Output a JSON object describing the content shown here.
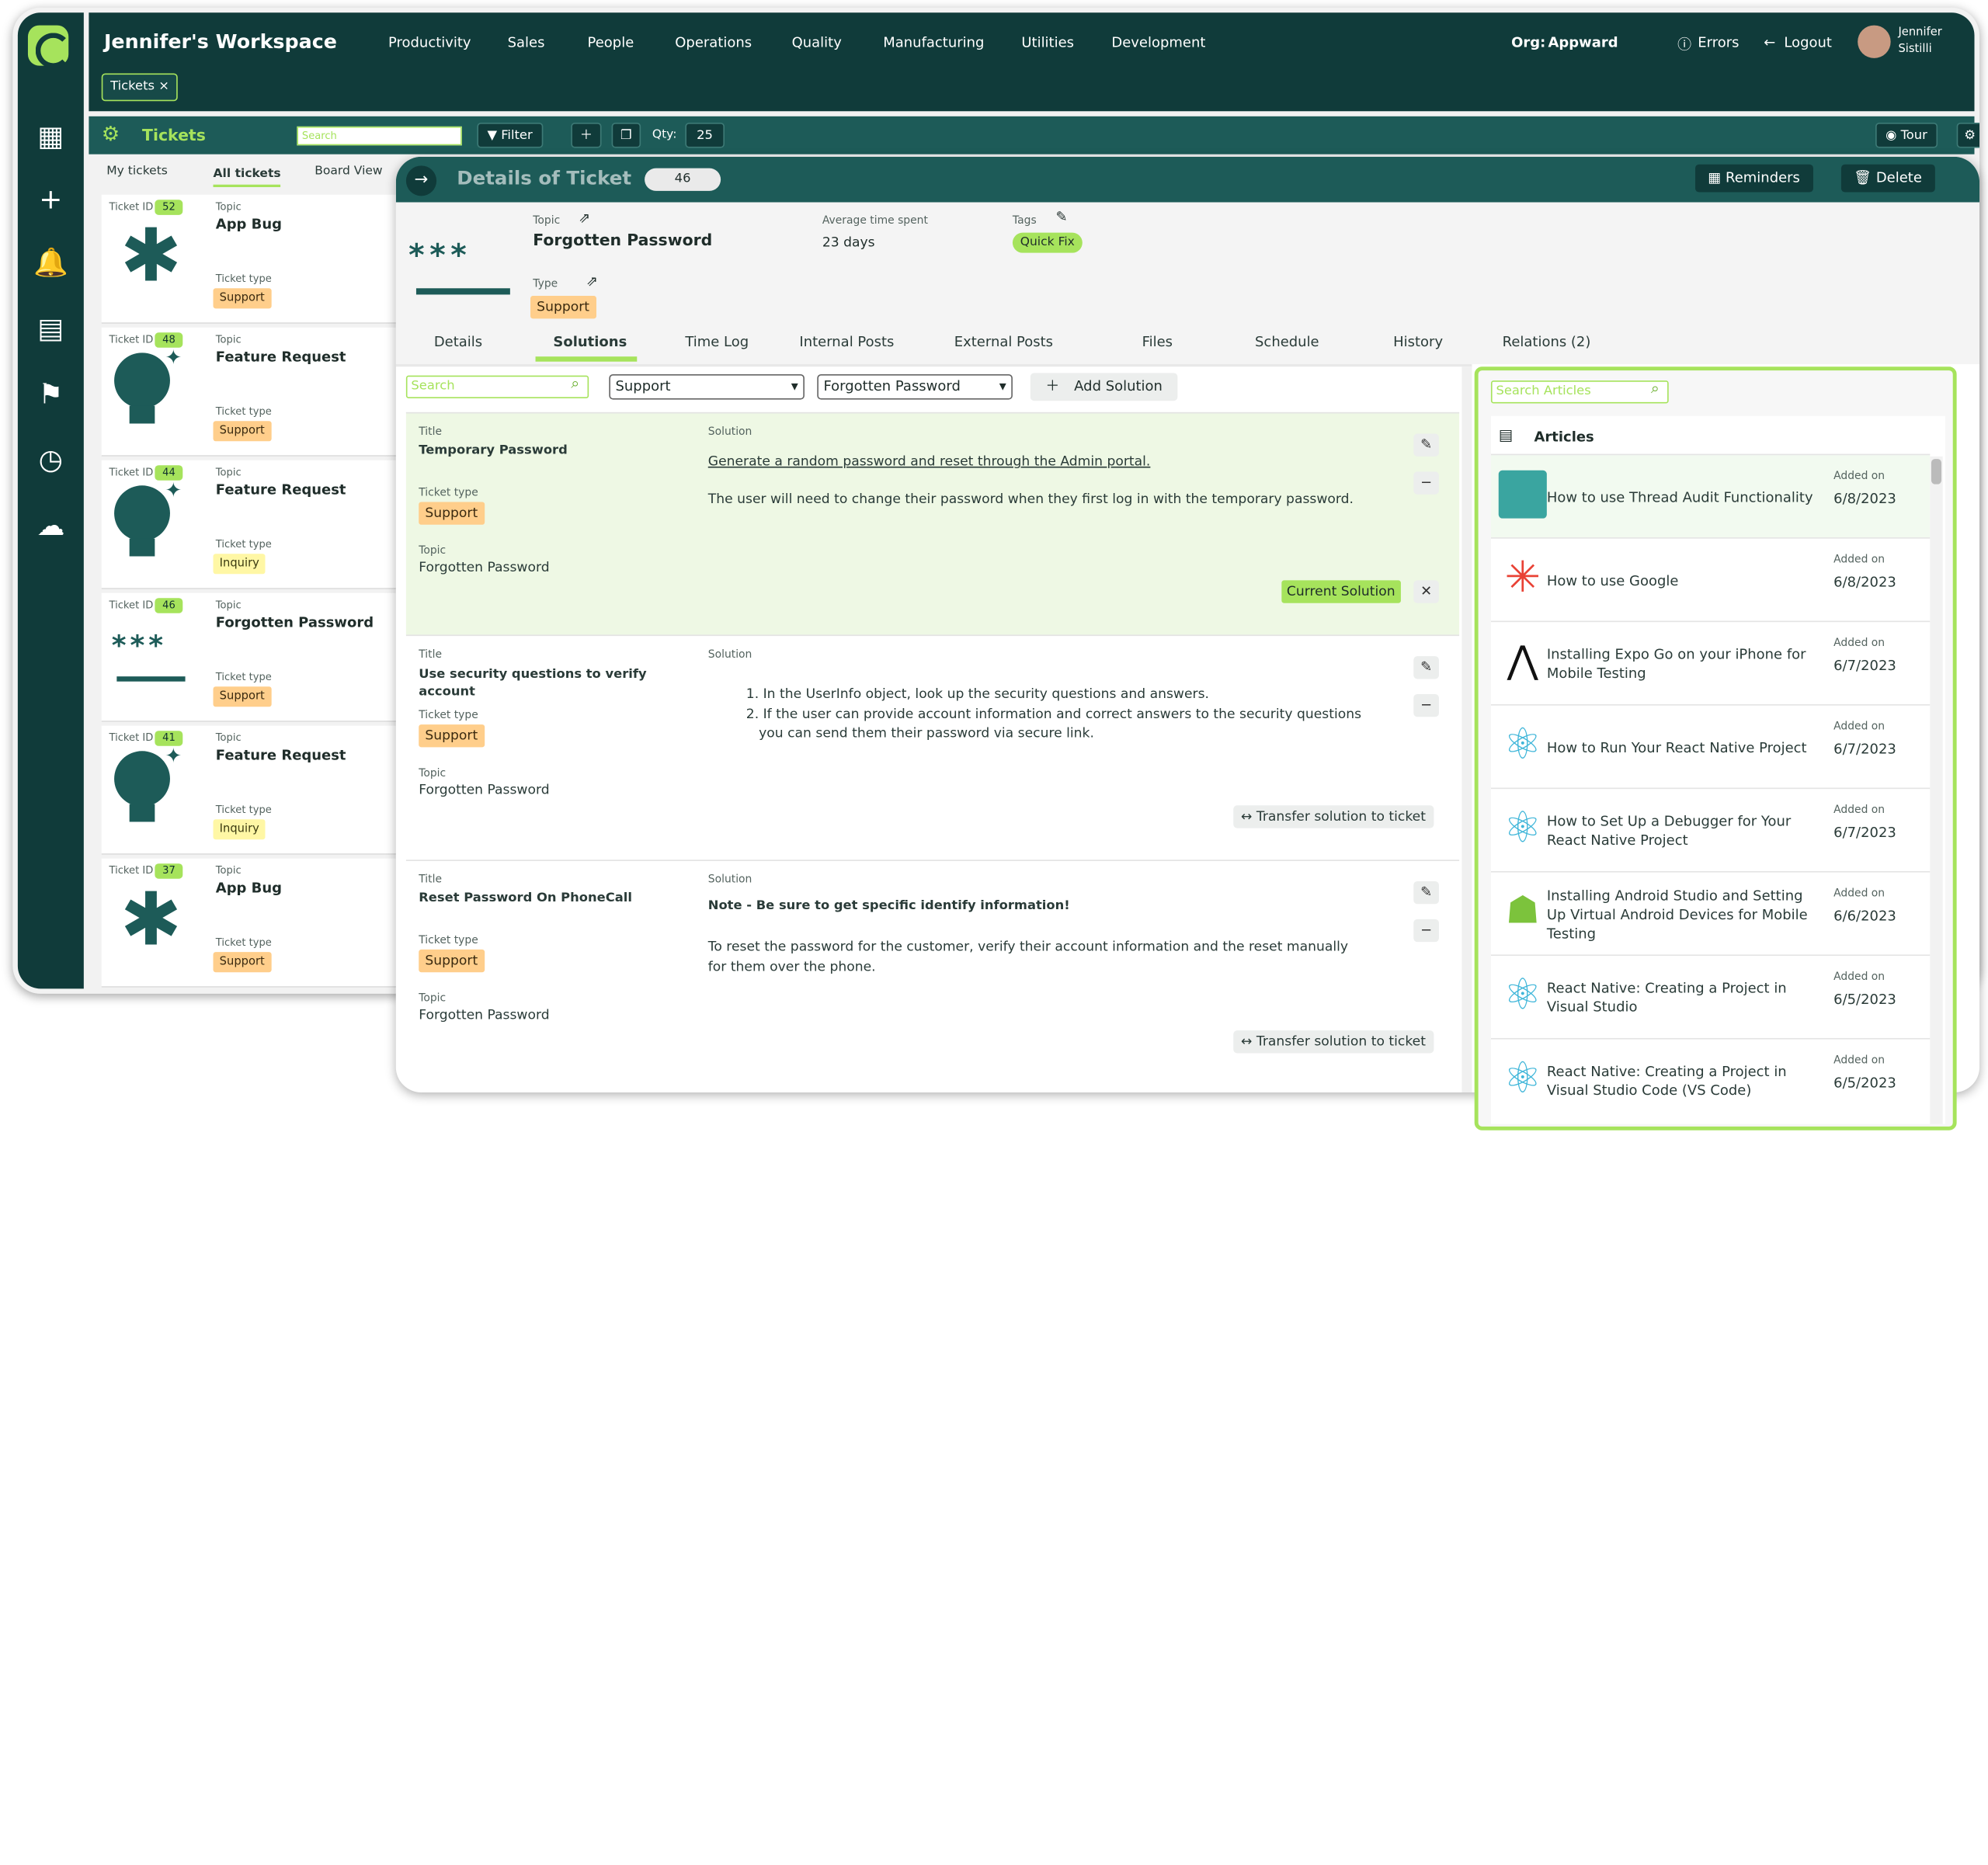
{
  "app": {
    "workspace_title": "Jennifer's Workspace",
    "org_label": "Org:",
    "org_name": "Appward",
    "errors": "Errors",
    "logout": "Logout",
    "user_first": "Jennifer",
    "user_last": "Sistilli",
    "open_tab": "Tickets"
  },
  "nav": [
    "Productivity",
    "Sales",
    "People",
    "Operations",
    "Quality",
    "Manufacturing",
    "Utilities",
    "Development"
  ],
  "toolbar": {
    "title": "Tickets",
    "search_placeholder": "Search",
    "filter": "Filter",
    "qty_label": "Qty:",
    "qty": "25",
    "tour": "Tour"
  },
  "left_tabs": [
    "My tickets",
    "All tickets",
    "Board View"
  ],
  "ticket_labels": {
    "id": "Ticket ID",
    "topic": "Topic",
    "type": "Ticket type"
  },
  "tickets": [
    {
      "id": "52",
      "topic": "App Bug",
      "type": "Support",
      "icon": "bug-icon"
    },
    {
      "id": "48",
      "topic": "Feature Request",
      "type": "Support",
      "icon": "lightbulb-icon"
    },
    {
      "id": "44",
      "topic": "Feature Request",
      "type": "Inquiry",
      "icon": "lightbulb-icon"
    },
    {
      "id": "46",
      "topic": "Forgotten Password",
      "type": "Support",
      "icon": "password-icon"
    },
    {
      "id": "41",
      "topic": "Feature Request",
      "type": "Inquiry",
      "icon": "lightbulb-icon"
    },
    {
      "id": "37",
      "topic": "App Bug",
      "type": "Support",
      "icon": "bug-icon"
    }
  ],
  "detail": {
    "title": "Details of Ticket",
    "id": "46",
    "reminders": "Reminders",
    "delete": "Delete",
    "topic_label": "Topic",
    "topic": "Forgotten Password",
    "type_label": "Type",
    "type": "Support",
    "avg_label": "Average time spent",
    "avg": "23 days",
    "tags_label": "Tags",
    "tag": "Quick Fix",
    "tabs": [
      "Details",
      "Solutions",
      "Time Log",
      "Internal Posts",
      "External Posts",
      "Files",
      "Schedule",
      "History",
      "Relations (2)"
    ],
    "search_placeholder": "Search",
    "type_filter": "Support",
    "topic_filter": "Forgotten Password",
    "add_solution": "Add Solution"
  },
  "solution_labels": {
    "title": "Title",
    "solution": "Solution",
    "type": "Ticket type",
    "topic": "Topic",
    "current": "Current Solution",
    "transfer": "Transfer solution to ticket"
  },
  "solutions": [
    {
      "title": "Temporary Password",
      "type": "Support",
      "topic": "Forgotten Password",
      "link": "Generate a random password and reset through the Admin portal.",
      "text": "The user will need to change their password when they first log in with the temporary password."
    },
    {
      "title": "Use security questions to verify account",
      "type": "Support",
      "topic": "Forgotten Password",
      "step1": "1. In the UserInfo object, look up the security questions and answers.",
      "step2": "2. If the user can provide account information and correct answers to the security questions",
      "step2b": "you can send them their password via secure link."
    },
    {
      "title": "Reset Password On PhoneCall",
      "type": "Support",
      "topic": "Forgotten Password",
      "note": "Note - Be sure to get specific identify information!",
      "text1": "To reset the password for the customer, verify their account information and the reset manually",
      "text2": "for them over the phone."
    }
  ],
  "articles_panel": {
    "search_placeholder": "Search Articles",
    "header": "Articles",
    "added_label": "Added on"
  },
  "articles": [
    {
      "title": "How to use Thread Audit Functionality",
      "date": "6/8/2023",
      "icon": "avatar-icon"
    },
    {
      "title": "How to use Google",
      "date": "6/8/2023",
      "icon": "google-icon"
    },
    {
      "title": "Installing Expo Go on your iPhone for Mobile Testing",
      "date": "6/7/2023",
      "icon": "expo-icon"
    },
    {
      "title": "How to Run Your React Native Project",
      "date": "6/7/2023",
      "icon": "react-icon"
    },
    {
      "title": "How to Set Up a Debugger for Your React Native Project",
      "date": "6/7/2023",
      "icon": "react-icon"
    },
    {
      "title": "Installing Android Studio and Setting Up Virtual Android Devices for Mobile Testing",
      "date": "6/6/2023",
      "icon": "android-icon"
    },
    {
      "title": "React Native: Creating a Project in Visual Studio",
      "date": "6/5/2023",
      "icon": "react-icon"
    },
    {
      "title": "React Native: Creating a Project in Visual Studio Code (VS Code)",
      "date": "6/5/2023",
      "icon": "react-icon"
    }
  ],
  "colors": {
    "dark_teal": "#103b3a",
    "mid_teal": "#1d5b58",
    "lime": "#a6e35c",
    "support": "#ffce8b",
    "inquiry": "#fff7a5",
    "current_bg": "#eef8e4"
  }
}
